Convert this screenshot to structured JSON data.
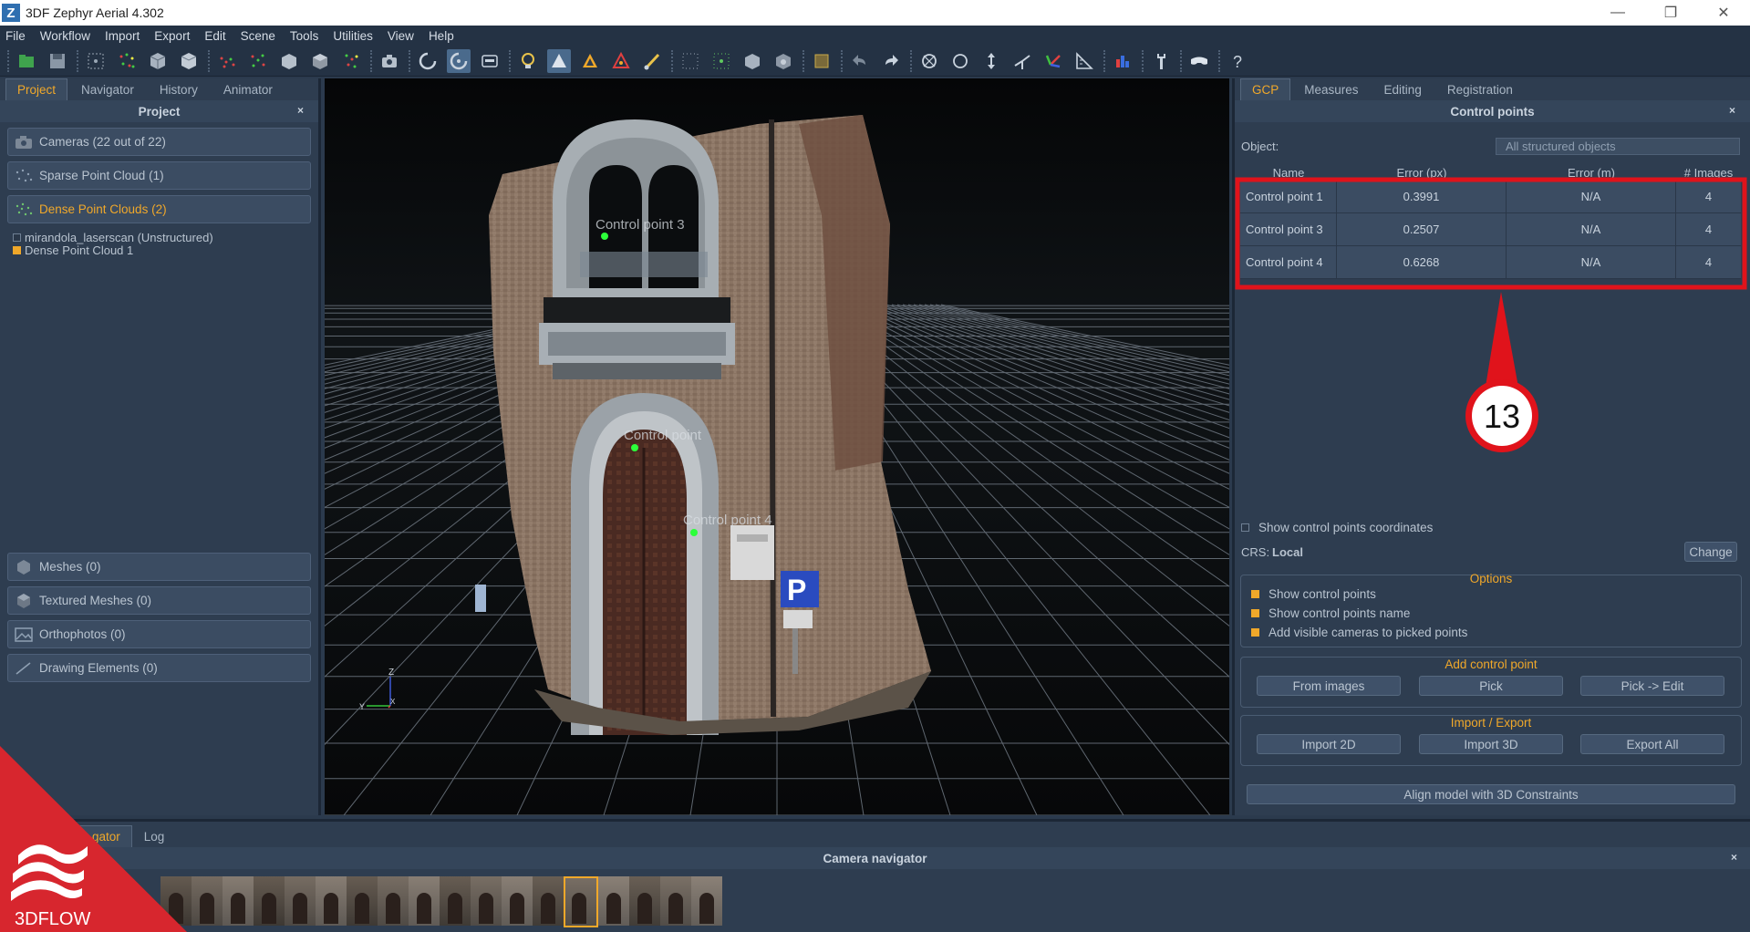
{
  "window": {
    "app_icon_letter": "Z",
    "title": "3DF Zephyr Aerial 4.302",
    "minimize": "—",
    "restore": "❐",
    "close": "✕"
  },
  "menu": [
    "File",
    "Workflow",
    "Import",
    "Export",
    "Edit",
    "Scene",
    "Tools",
    "Utilities",
    "View",
    "Help"
  ],
  "left_panel": {
    "tabs": [
      "Project",
      "Navigator",
      "History",
      "Animator"
    ],
    "active_tab": "Project",
    "header": "Project",
    "close": "×",
    "items_top": [
      {
        "label": "Cameras (22 out of 22)",
        "icon": "camera-icon"
      },
      {
        "label": "Sparse Point Cloud (1)",
        "icon": "sparse-cloud-icon"
      },
      {
        "label": "Dense Point Clouds (2)",
        "icon": "dense-cloud-icon"
      }
    ],
    "tree": [
      {
        "label": "mirandola_laserscan (Unstructured)",
        "checked": false
      },
      {
        "label": "Dense Point Cloud 1",
        "checked": true
      }
    ],
    "items_bottom": [
      {
        "label": "Meshes (0)",
        "icon": "mesh-icon"
      },
      {
        "label": "Textured Meshes (0)",
        "icon": "textured-mesh-icon"
      },
      {
        "label": "Orthophotos (0)",
        "icon": "orthophoto-icon"
      },
      {
        "label": "Drawing Elements (0)",
        "icon": "drawing-icon"
      }
    ]
  },
  "viewport": {
    "labels": [
      "Control point 3",
      "Control point",
      "Control point 4"
    ],
    "axis_labels": {
      "z": "Z",
      "y": "Y",
      "x": "X"
    }
  },
  "right_panel": {
    "tabs": [
      "GCP",
      "Measures",
      "Editing",
      "Registration"
    ],
    "active_tab": "GCP",
    "header": "Control points",
    "close": "×",
    "object_label": "Object:",
    "object_value": "All structured objects",
    "table": {
      "columns": [
        "Name",
        "Error (px)",
        "Error (m)",
        "# Images"
      ],
      "rows": [
        {
          "name": "Control point 1",
          "error_px": "0.3991",
          "error_m": "N/A",
          "images": "4"
        },
        {
          "name": "Control point 3",
          "error_px": "0.2507",
          "error_m": "N/A",
          "images": "4"
        },
        {
          "name": "Control point 4",
          "error_px": "0.6268",
          "error_m": "N/A",
          "images": "4"
        }
      ]
    },
    "callout_number": "13",
    "show_coords_label": "Show control points coordinates",
    "crs_label": "CRS:",
    "crs_value": "Local",
    "change_button": "Change",
    "options": {
      "title": "Options",
      "items": [
        "Show control points",
        "Show control points name",
        "Add visible cameras to picked points"
      ]
    },
    "add_cp": {
      "title": "Add control point",
      "buttons": [
        "From images",
        "Pick",
        "Pick -> Edit"
      ]
    },
    "import_export": {
      "title": "Import / Export",
      "buttons": [
        "Import 2D",
        "Import 3D",
        "Export All"
      ]
    },
    "align_button": "Align model with 3D Constraints"
  },
  "bottom_panel": {
    "tabs": [
      "Navigator",
      "Log"
    ],
    "visible_tab_text": "gator",
    "active_tab": "Navigator",
    "header": "Camera navigator",
    "close": "×",
    "thumbnail_count": 18,
    "selected_thumbnail": 13
  },
  "brand": {
    "text": "3DFLOW",
    "color": "#d7262e"
  },
  "colors": {
    "accent": "#f0a82a",
    "highlight_box": "#e0131b",
    "point": "#2cff3a"
  }
}
